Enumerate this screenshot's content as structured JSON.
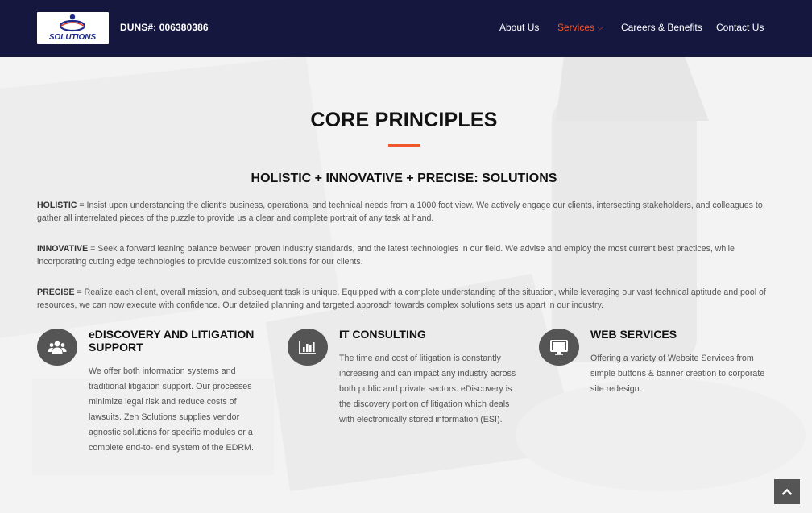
{
  "header": {
    "logo_text": "SOLUTIONS",
    "duns": "DUNS#: 006380386",
    "nav": [
      {
        "label": "About Us"
      },
      {
        "label": "Services"
      },
      {
        "label": "Careers & Benefits"
      },
      {
        "label": "Contact Us"
      }
    ],
    "active_nav": "Services"
  },
  "main": {
    "title": "CORE PRINCIPLES",
    "subtitle": "HOLISTIC + INNOVATIVE + PRECISE: SOLUTIONS",
    "principles": [
      {
        "term": "HOLISTIC",
        "text": " = Insist upon understanding the client's business, operational and technical needs from a 1000 foot view. We actively engage our clients, intersecting stakeholders, and colleagues to gather all interrelated pieces of the puzzle to provide us a clear and complete portrait of any task at hand."
      },
      {
        "term": "INNOVATIVE",
        "text": " = Seek a forward leaning balance between proven industry standards, and the latest technologies in our field. We advise and employ the most current best practices, while incorporating cutting edge technologies to provide customized solutions for our clients."
      },
      {
        "term": "PRECISE",
        "text": " = Realize each client, overall mission, and subsequent task is unique. Equipped with a complete understanding of the situation, while leveraging our vast technical aptitude and pool of resources, we can now execute with confidence. Our detailed planning and targeted approach towards complex solutions sets us apart in our industry."
      }
    ],
    "services": [
      {
        "icon": "users-icon",
        "title": "eDISCOVERY AND LITIGATION SUPPORT",
        "text": "We offer both information systems and traditional litigation support. Our processes minimize legal risk and reduce costs of lawsuits. Zen Solutions supplies vendor agnostic solutions for specific modules or a complete end-to- end system of the EDRM."
      },
      {
        "icon": "bar-chart-icon",
        "title": "IT CONSULTING",
        "text": "The time and cost of litigation is constantly increasing and can impact any industry across both public and private sectors. eDiscovery is the discovery portion of litigation which deals with electronically stored information (ESI)."
      },
      {
        "icon": "monitor-icon",
        "title": "WEB SERVICES",
        "text": "Offering a variety of Website Services from simple buttons & banner creation to corporate site redesign."
      }
    ]
  },
  "colors": {
    "header_bg": "#15173f",
    "accent": "#f0572a",
    "icon_bg": "#555555"
  }
}
